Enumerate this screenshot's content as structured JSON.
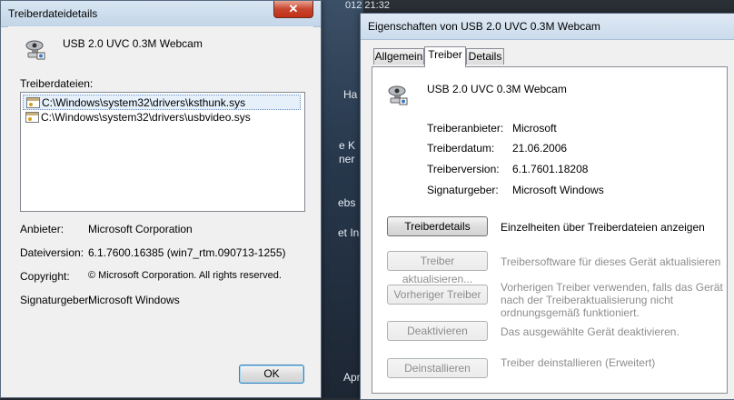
{
  "background": {
    "time": "012 21:32",
    "fragments": [
      "Ha",
      "e K",
      "ner",
      "ebs",
      "et In",
      "Apr"
    ]
  },
  "details_dialog": {
    "title": "Treiberdateidetails",
    "close_label": "✕",
    "device_name": "USB 2.0 UVC 0.3M Webcam",
    "files_label": "Treiberdateien:",
    "files": [
      "C:\\Windows\\system32\\drivers\\ksthunk.sys",
      "C:\\Windows\\system32\\drivers\\usbvideo.sys"
    ],
    "props": {
      "provider_label": "Anbieter:",
      "provider_value": "Microsoft Corporation",
      "version_label": "Dateiversion:",
      "version_value": "6.1.7600.16385 (win7_rtm.090713-1255)",
      "copyright_label": "Copyright:",
      "copyright_value": "© Microsoft Corporation. All rights reserved.",
      "signer_label": "Signaturgeber:",
      "signer_value": "Microsoft Windows"
    },
    "ok_label": "OK"
  },
  "properties_dialog": {
    "title": "Eigenschaften von USB 2.0 UVC 0.3M Webcam",
    "tabs": [
      "Allgemein",
      "Treiber",
      "Details"
    ],
    "device_name": "USB 2.0 UVC 0.3M Webcam",
    "info": {
      "provider_label": "Treiberanbieter:",
      "provider_value": "Microsoft",
      "date_label": "Treiberdatum:",
      "date_value": "21.06.2006",
      "version_label": "Treiberversion:",
      "version_value": "6.1.7601.18208",
      "signer_label": "Signaturgeber:",
      "signer_value": "Microsoft Windows"
    },
    "actions": {
      "details_button": "Treiberdetails",
      "details_desc": "Einzelheiten über Treiberdateien anzeigen",
      "update_button": "Treiber aktualisieren...",
      "update_desc": "Treibersoftware für dieses Gerät aktualisieren",
      "rollback_button": "Vorheriger Treiber",
      "rollback_desc_1": "Vorherigen Treiber verwenden, falls das Gerät",
      "rollback_desc_2": "nach der Treiberaktualisierung nicht",
      "rollback_desc_3": "ordnungsgemäß funktioniert.",
      "disable_button": "Deaktivieren",
      "disable_desc": "Das ausgewählte Gerät deaktivieren.",
      "uninstall_button": "Deinstallieren",
      "uninstall_desc": "Treiber deinstallieren (Erweitert)"
    }
  },
  "icons": {
    "device": "webcam-icon",
    "file": "driver-file-icon",
    "close": "close-icon"
  }
}
